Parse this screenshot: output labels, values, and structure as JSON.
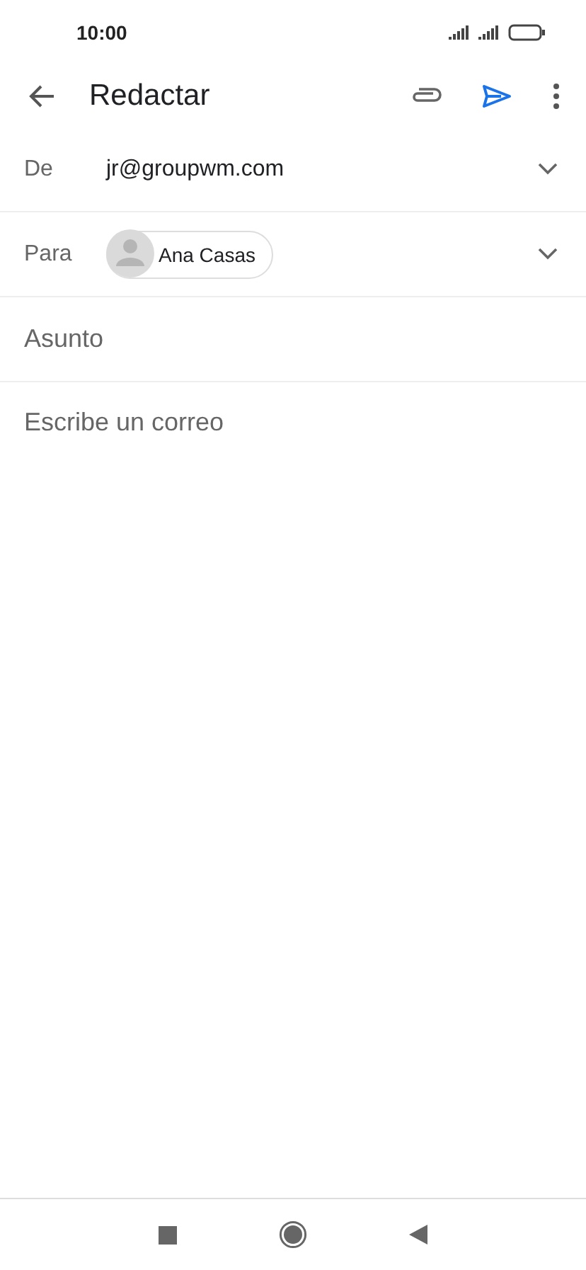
{
  "status_bar": {
    "time": "10:00"
  },
  "toolbar": {
    "title": "Redactar"
  },
  "from": {
    "label": "De",
    "value": "jr@groupwm.com"
  },
  "to": {
    "label": "Para",
    "recipients": [
      {
        "name": "Ana Casas"
      }
    ]
  },
  "subject": {
    "placeholder": "Asunto"
  },
  "body": {
    "placeholder": "Escribe un correo"
  }
}
